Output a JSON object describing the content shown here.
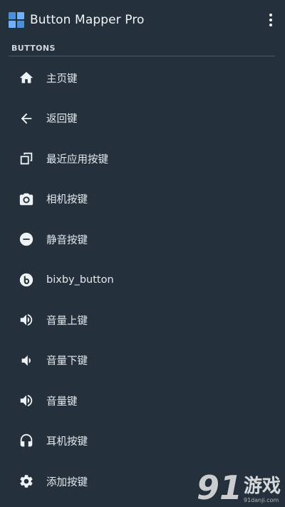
{
  "appbar": {
    "title": "Button Mapper Pro",
    "app_icon": "button-mapper-app-icon",
    "menu_icon": "more-vert-icon"
  },
  "section": {
    "header": "BUTTONS"
  },
  "items": [
    {
      "label": "主页键",
      "icon": "home-icon"
    },
    {
      "label": "返回键",
      "icon": "arrow-back-icon"
    },
    {
      "label": "最近应用按键",
      "icon": "recent-apps-icon"
    },
    {
      "label": "相机按键",
      "icon": "camera-icon"
    },
    {
      "label": "静音按键",
      "icon": "mute-icon"
    },
    {
      "label": "bixby_button",
      "icon": "bixby-icon"
    },
    {
      "label": "音量上键",
      "icon": "volume-up-icon"
    },
    {
      "label": "音量下键",
      "icon": "volume-down-icon"
    },
    {
      "label": "音量键",
      "icon": "volume-icon"
    },
    {
      "label": "耳机按键",
      "icon": "headset-icon"
    },
    {
      "label": "添加按键",
      "icon": "settings-gear-icon"
    }
  ],
  "watermark": {
    "number": "91",
    "text": "游戏",
    "url": "91danji.com"
  },
  "colors": {
    "background": "#24313d",
    "text": "#e4e9ed",
    "divider": "#4c5a66"
  }
}
